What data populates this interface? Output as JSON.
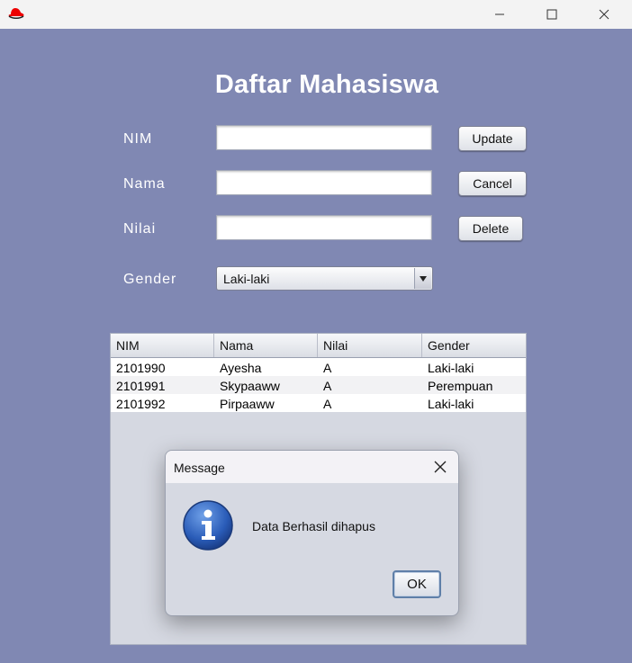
{
  "window": {
    "icon": "redhat-icon",
    "minimize_glyph": "—",
    "maximize_glyph": "☐",
    "close_glyph": "✕"
  },
  "form": {
    "title": "Daftar Mahasiswa",
    "nim_label": "NIM",
    "nama_label": "Nama",
    "nilai_label": "Nilai",
    "gender_label": "Gender",
    "nim_value": "",
    "nama_value": "",
    "nilai_value": "",
    "gender_selected": "Laki-laki",
    "update_label": "Update",
    "cancel_label": "Cancel",
    "delete_label": "Delete"
  },
  "table": {
    "columns": [
      "NIM",
      "Nama",
      "Nilai",
      "Gender"
    ],
    "rows": [
      [
        "2101990",
        "Ayesha",
        "A",
        "Laki-laki"
      ],
      [
        "2101991",
        "Skypaaww",
        "A",
        "Perempuan"
      ],
      [
        "2101992",
        "Pirpaaww",
        "A",
        "Laki-laki"
      ]
    ]
  },
  "dialog": {
    "title": "Message",
    "message": "Data Berhasil dihapus",
    "ok_label": "OK",
    "icon": "info-icon"
  },
  "colors": {
    "background": "#8088b3",
    "titlebar": "#f3f3f3",
    "dialog_bg": "#d6d9e2"
  }
}
